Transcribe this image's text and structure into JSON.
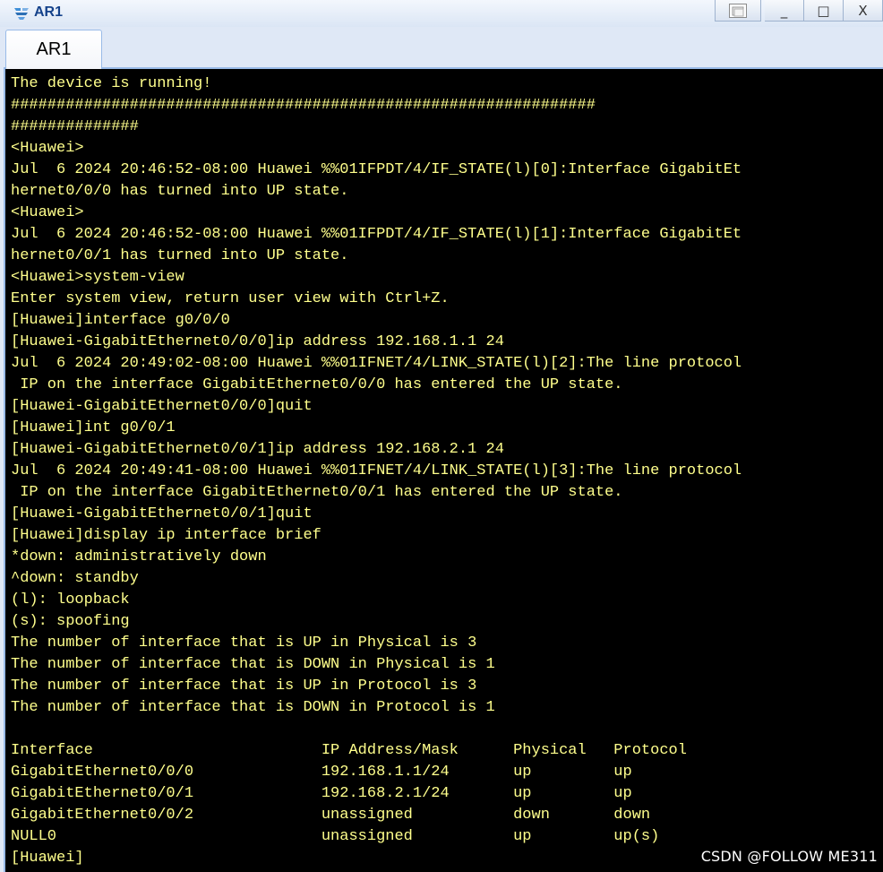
{
  "window": {
    "title": "AR1",
    "controls": {
      "restore_icon": "restore-icon",
      "minimize_label": "_",
      "maximize_label": "□",
      "close_label": "X"
    }
  },
  "tabs": [
    {
      "label": "AR1",
      "active": true
    }
  ],
  "console": {
    "lines": [
      "The device is running!",
      "################################################################",
      "##############",
      "<Huawei>",
      "Jul  6 2024 20:46:52-08:00 Huawei %%01IFPDT/4/IF_STATE(l)[0]:Interface GigabitEt",
      "hernet0/0/0 has turned into UP state.",
      "<Huawei>",
      "Jul  6 2024 20:46:52-08:00 Huawei %%01IFPDT/4/IF_STATE(l)[1]:Interface GigabitEt",
      "hernet0/0/1 has turned into UP state.",
      "<Huawei>system-view",
      "Enter system view, return user view with Ctrl+Z.",
      "[Huawei]interface g0/0/0",
      "[Huawei-GigabitEthernet0/0/0]ip address 192.168.1.1 24",
      "Jul  6 2024 20:49:02-08:00 Huawei %%01IFNET/4/LINK_STATE(l)[2]:The line protocol",
      " IP on the interface GigabitEthernet0/0/0 has entered the UP state.",
      "[Huawei-GigabitEthernet0/0/0]quit",
      "[Huawei]int g0/0/1",
      "[Huawei-GigabitEthernet0/0/1]ip address 192.168.2.1 24",
      "Jul  6 2024 20:49:41-08:00 Huawei %%01IFNET/4/LINK_STATE(l)[3]:The line protocol",
      " IP on the interface GigabitEthernet0/0/1 has entered the UP state.",
      "[Huawei-GigabitEthernet0/0/1]quit",
      "[Huawei]display ip interface brief",
      "*down: administratively down",
      "^down: standby",
      "(l): loopback",
      "(s): spoofing",
      "The number of interface that is UP in Physical is 3",
      "The number of interface that is DOWN in Physical is 1",
      "The number of interface that is UP in Protocol is 3",
      "The number of interface that is DOWN in Protocol is 1",
      "",
      "Interface                         IP Address/Mask      Physical   Protocol",
      "GigabitEthernet0/0/0              192.168.1.1/24       up         up",
      "GigabitEthernet0/0/1              192.168.2.1/24       up         up",
      "GigabitEthernet0/0/2              unassigned           down       down",
      "NULL0                             unassigned           up         up(s)",
      "[Huawei]"
    ]
  },
  "watermark": "CSDN @FOLLOW ME311",
  "colors": {
    "console_bg": "#000000",
    "console_text": "#ffff8c",
    "title_text": "#15428b"
  }
}
